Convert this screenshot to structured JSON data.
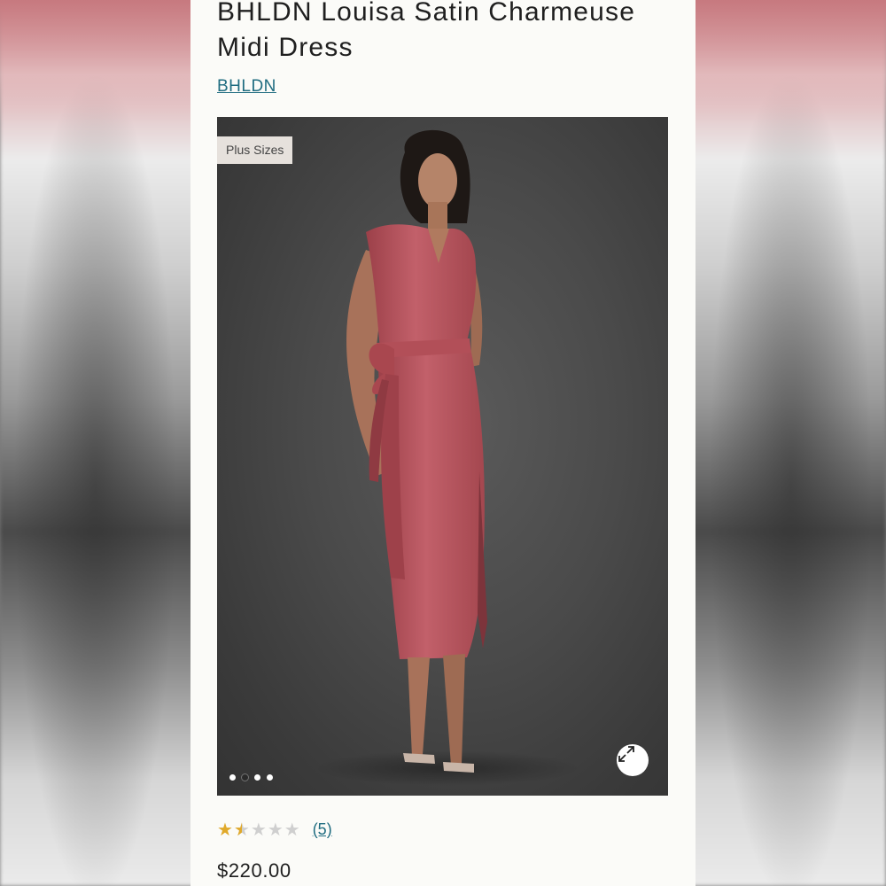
{
  "product": {
    "title": "BHLDN Louisa Satin Charmeuse Midi Dress",
    "brand": "BHLDN",
    "badge": "Plus Sizes",
    "rating_value": 1.5,
    "rating_max": 5,
    "review_count": "(5)",
    "price": "$220.00",
    "image_dots": 4,
    "active_dot_index": 0
  },
  "colors": {
    "dress": "#b9545d",
    "link": "#1f6c80",
    "star_filled": "#e0a92a",
    "star_empty": "#cfcfcf"
  },
  "icons": {
    "expand": "expand-arrows-icon",
    "star": "star-icon"
  }
}
